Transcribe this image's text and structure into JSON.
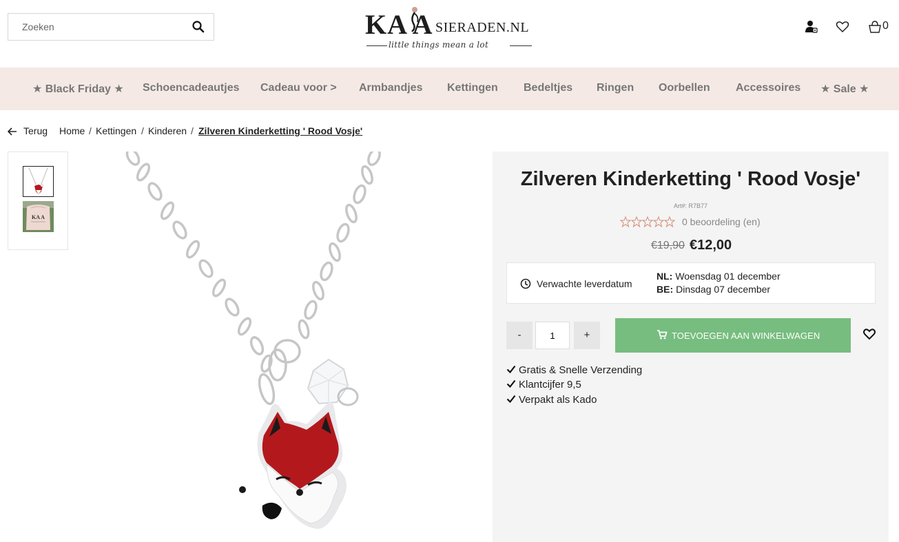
{
  "header": {
    "search_placeholder": "Zoeken",
    "logo_main": "KA  A",
    "logo_small": "SIERADEN.NL",
    "logo_tagline": "little things mean a lot",
    "cart_count": "0"
  },
  "nav": {
    "items": [
      {
        "label": "★ Black Friday ★"
      },
      {
        "label": "Schoencadeautjes"
      },
      {
        "label": "Cadeau voor >"
      },
      {
        "label": "Armbandjes"
      },
      {
        "label": "Kettingen"
      },
      {
        "label": "Bedeltjes"
      },
      {
        "label": "Ringen"
      },
      {
        "label": "Oorbellen"
      },
      {
        "label": "Accessoires"
      },
      {
        "label": "★ Sale ★"
      }
    ]
  },
  "breadcrumb": {
    "back": "Terug",
    "items": [
      "Home",
      "Kettingen",
      "Kinderen",
      "Zilveren Kinderketting ' Rood Vosje'"
    ]
  },
  "product": {
    "title": "Zilveren Kinderketting ' Rood Vosje'",
    "article": "Art#: R7B77",
    "rating": 0,
    "reviews": "0 beoordeling (en)",
    "old_price": "€19,90",
    "price": "€12,00",
    "delivery_label": "Verwachte leverdatum",
    "delivery": [
      {
        "country": "NL:",
        "date": "Woensdag 01 december"
      },
      {
        "country": "BE:",
        "date": "Dinsdag 07 december"
      }
    ],
    "qty_minus": "-",
    "qty_value": "1",
    "qty_plus": "+",
    "add_to_cart": "TOEVOEGEN AAN WINKELWAGEN",
    "usps": [
      "Gratis & Snelle Verzending",
      "Klantcijfer 9,5",
      "Verpakt als Kado"
    ]
  },
  "colors": {
    "nav_bg": "#f4e9e5",
    "button_green": "#77bd7f",
    "fox_red": "#b3191c"
  }
}
